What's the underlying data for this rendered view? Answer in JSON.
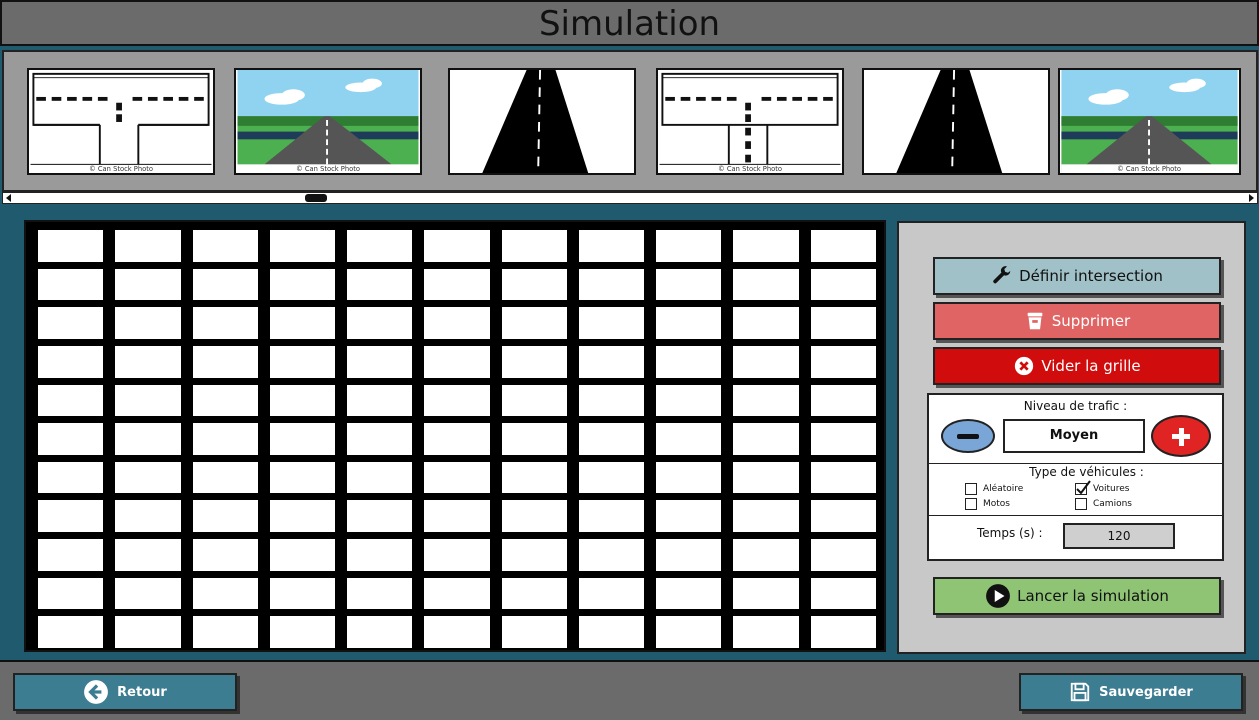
{
  "title": "Simulation",
  "thumbnails": [
    {
      "type": "t-intersection",
      "icon": "t-intersection-icon",
      "caption": "© Can Stock Photo"
    },
    {
      "type": "landscape-road",
      "icon": "landscape-road-icon",
      "caption": "© Can Stock Photo"
    },
    {
      "type": "straight-road",
      "icon": "straight-road-icon",
      "caption": ""
    },
    {
      "type": "t-intersection",
      "icon": "t-intersection-icon",
      "caption": "© Can Stock Photo"
    },
    {
      "type": "straight-road",
      "icon": "straight-road-icon",
      "caption": ""
    },
    {
      "type": "landscape-road",
      "icon": "landscape-road-icon",
      "caption": "© Can Stock Photo"
    }
  ],
  "strip_scroll_position": 0.24,
  "grid": {
    "rows": 11,
    "cols": 11
  },
  "panel": {
    "define_label": "Définir intersection",
    "delete_label": "Supprimer",
    "clear_label": "Vider la grille",
    "traffic_label": "Niveau de trafic :",
    "traffic_value": "Moyen",
    "vehicle_types_label": "Type de véhicules :",
    "vehicles": {
      "aleatoire": {
        "label": "Aléatoire",
        "checked": false
      },
      "voitures": {
        "label": "Voitures",
        "checked": true
      },
      "motos": {
        "label": "Motos",
        "checked": false
      },
      "camions": {
        "label": "Camions",
        "checked": false
      }
    },
    "time_label": "Temps (s) :",
    "time_value": "120",
    "launch_label": "Lancer la simulation"
  },
  "footer": {
    "back_label": "Retour",
    "save_label": "Sauvegarder"
  },
  "colors": {
    "define": "#a0c1c8",
    "delete": "#e06464",
    "clear": "#d00c0c",
    "launch": "#8fc475",
    "nav": "#3d7d92",
    "minus": "#79a6d6",
    "plus": "#e02424"
  }
}
